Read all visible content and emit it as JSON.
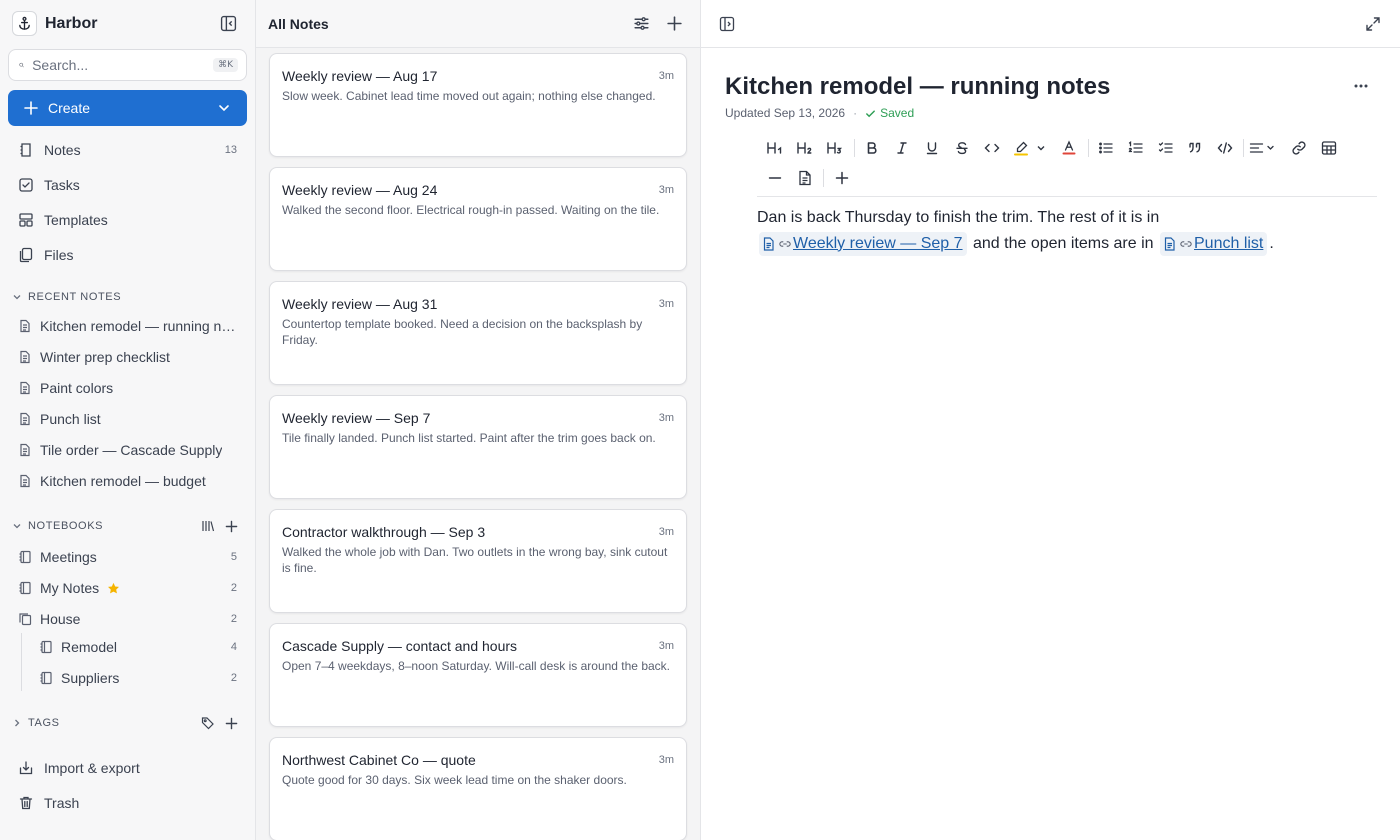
{
  "app": {
    "name": "Harbor"
  },
  "search": {
    "placeholder": "Search...",
    "shortcut": "⌘K"
  },
  "create": {
    "label": "Create"
  },
  "nav": [
    {
      "label": "Notes",
      "count": "13",
      "icon": "notes-icon"
    },
    {
      "label": "Tasks",
      "count": "",
      "icon": "tasks-icon"
    },
    {
      "label": "Templates",
      "count": "",
      "icon": "templates-icon"
    },
    {
      "label": "Files",
      "count": "",
      "icon": "files-icon"
    }
  ],
  "recent": {
    "heading": "RECENT NOTES",
    "items": [
      "Kitchen remodel — running notes",
      "Winter prep checklist",
      "Paint colors",
      "Punch list",
      "Tile order — Cascade Supply",
      "Kitchen remodel — budget"
    ]
  },
  "notebooks": {
    "heading": "NOTEBOOKS",
    "items": [
      {
        "label": "Meetings",
        "count": "5"
      },
      {
        "label": "My Notes",
        "count": "2"
      },
      {
        "label": "House",
        "count": "2"
      },
      {
        "label": "Remodel",
        "count": "4"
      },
      {
        "label": "Suppliers",
        "count": "2"
      }
    ]
  },
  "tags": {
    "heading": "TAGS"
  },
  "footer": [
    {
      "label": "Import & export"
    },
    {
      "label": "Trash"
    }
  ],
  "list": {
    "title": "All Notes",
    "notes": [
      {
        "title": "Weekly review — Aug 17",
        "age": "3m",
        "snippet": "Slow week. Cabinet lead time moved out again; nothing else changed."
      },
      {
        "title": "Weekly review — Aug 24",
        "age": "3m",
        "snippet": "Walked the second floor. Electrical rough-in passed. Waiting on the tile."
      },
      {
        "title": "Weekly review — Aug 31",
        "age": "3m",
        "snippet": "Countertop template booked. Need a decision on the backsplash by Friday."
      },
      {
        "title": "Weekly review — Sep 7",
        "age": "3m",
        "snippet": "Tile finally landed. Punch list started. Paint after the trim goes back on."
      },
      {
        "title": "Contractor walkthrough — Sep 3",
        "age": "3m",
        "snippet": "Walked the whole job with Dan. Two outlets in the wrong bay, sink cutout is fine."
      },
      {
        "title": "Cascade Supply — contact and hours",
        "age": "3m",
        "snippet": "Open 7–4 weekdays, 8–noon Saturday. Will-call desk is around the back."
      },
      {
        "title": "Northwest Cabinet Co — quote",
        "age": "3m",
        "snippet": "Quote good for 30 days. Six week lead time on the shaker doors."
      }
    ]
  },
  "editor": {
    "title": "Kitchen remodel — running notes",
    "updated": "Updated Sep 13, 2026",
    "dot": "·",
    "saved": "Saved",
    "body": {
      "part1": "Dan is back Thursday to finish the trim. The rest of it is in ",
      "link1": "Weekly review — Sep 7",
      "part2": " and the open items are in ",
      "link2": "Punch list",
      "part3": "."
    },
    "toolbar": {
      "h1": "H1",
      "h2": "H2",
      "h3": "H3"
    }
  },
  "colors": {
    "accent": "#1f6fd1",
    "saved": "#2e9e55",
    "star": "#f5b400",
    "link": "#1f5fa8"
  }
}
